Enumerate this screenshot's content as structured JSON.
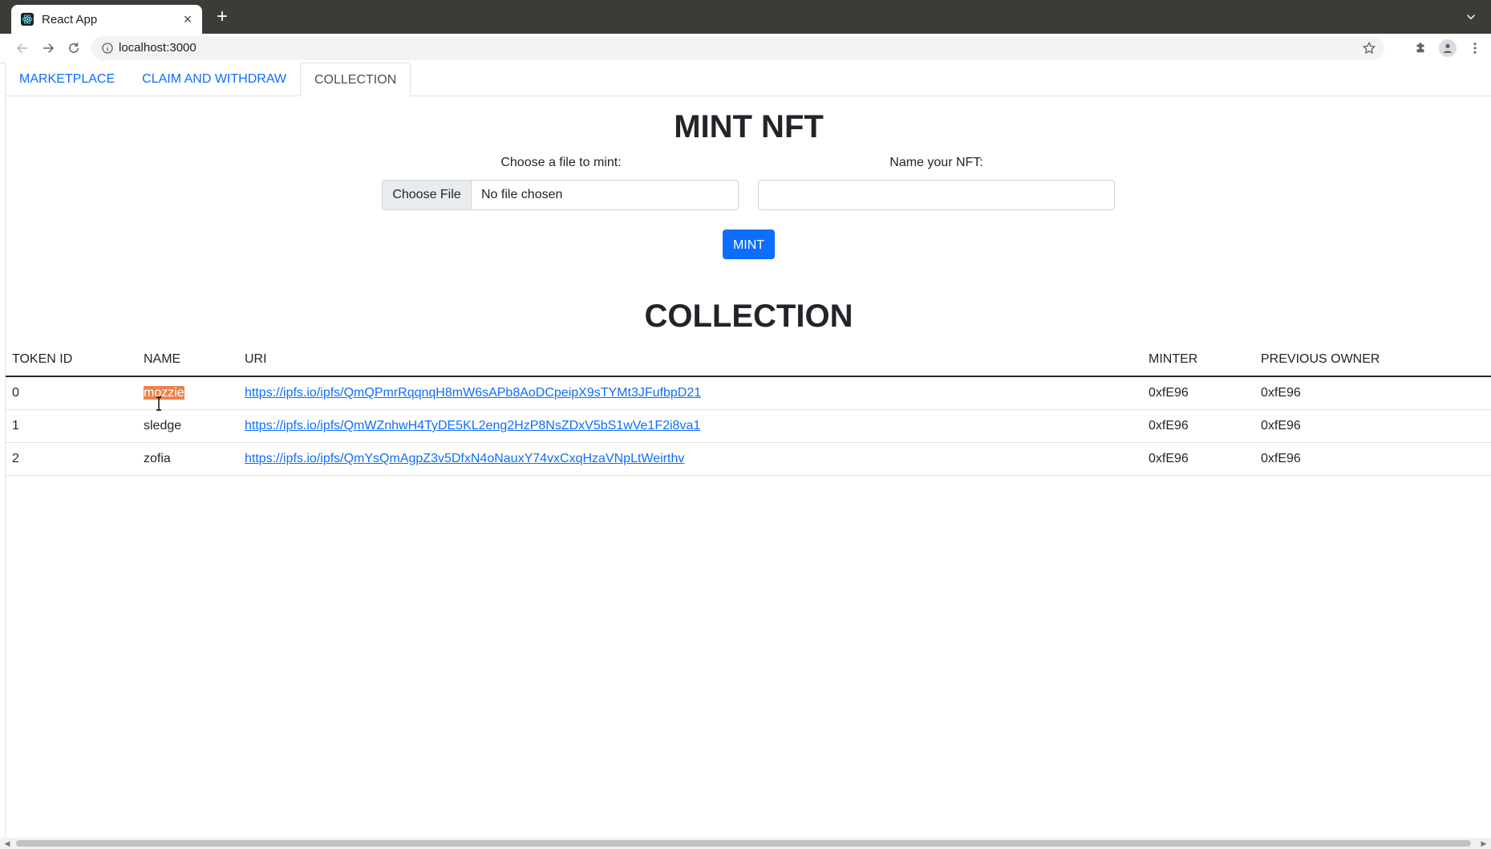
{
  "browser": {
    "tab_title": "React App",
    "url": "localhost:3000"
  },
  "nav_tabs": [
    {
      "label": "MARKETPLACE"
    },
    {
      "label": "CLAIM AND WITHDRAW"
    },
    {
      "label": "COLLECTION",
      "active": true
    }
  ],
  "mint": {
    "title": "MINT NFT",
    "file_label": "Choose a file to mint:",
    "file_button": "Choose File",
    "file_status": "No file chosen",
    "name_label": "Name your NFT:",
    "name_value": "",
    "button": "MINT"
  },
  "collection": {
    "title": "COLLECTION",
    "columns": [
      "TOKEN ID",
      "NAME",
      "URI",
      "MINTER",
      "PREVIOUS OWNER"
    ],
    "rows": [
      {
        "token_id": "0",
        "name": "mozzie",
        "uri": "https://ipfs.io/ipfs/QmQPmrRqqnqH8mW6sAPb8AoDCpeipX9sTYMt3JFufbpD21",
        "minter": "0xfE96",
        "previous_owner": "0xfE96"
      },
      {
        "token_id": "1",
        "name": "sledge",
        "uri": "https://ipfs.io/ipfs/QmWZnhwH4TyDE5KL2eng2HzP8NsZDxV5bS1wVe1F2i8va1",
        "minter": "0xfE96",
        "previous_owner": "0xfE96"
      },
      {
        "token_id": "2",
        "name": "zofia",
        "uri": "https://ipfs.io/ipfs/QmYsQmAgpZ3v5DfxN4oNauxY74vxCxqHzaVNpLtWeirthv",
        "minter": "0xfE96",
        "previous_owner": "0xfE96"
      }
    ]
  },
  "colors": {
    "primary": "#0d6efd",
    "selection": "#e9834f",
    "chrome_dark": "#3c3b37"
  }
}
